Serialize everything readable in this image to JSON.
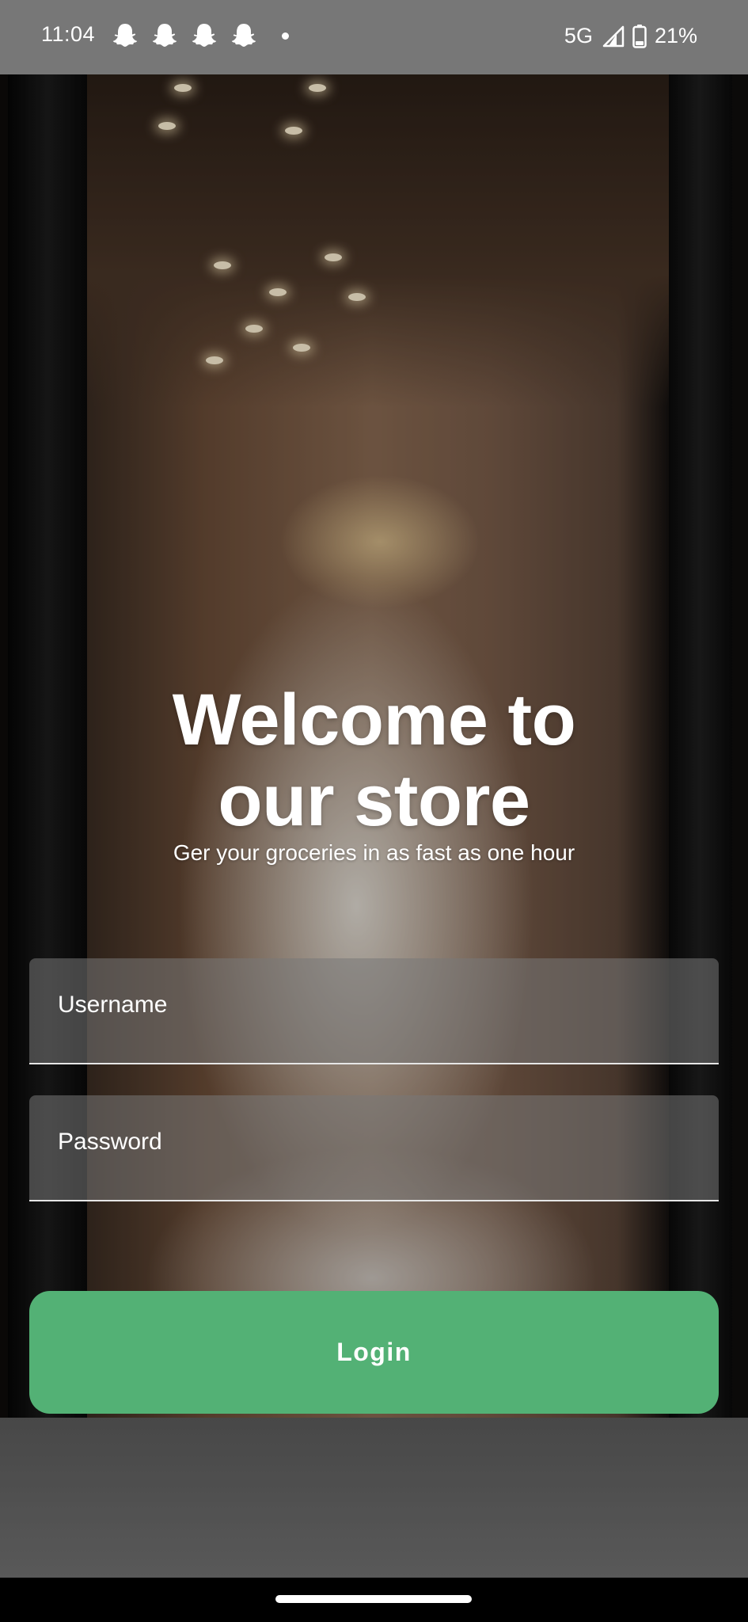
{
  "status_bar": {
    "time": "11:04",
    "notification_icons": [
      "snapchat-icon",
      "snapchat-icon",
      "snapchat-icon",
      "snapchat-icon"
    ],
    "network": "5G",
    "battery": "21%"
  },
  "welcome": {
    "title_line1": "Welcome to",
    "title_line2": "our store",
    "subtitle": "Ger your groceries in as fast as one hour"
  },
  "form": {
    "username_label": "Username",
    "password_label": "Password",
    "login_label": "Login"
  },
  "colors": {
    "accent": "#53b175",
    "status_bar": "#777777"
  }
}
